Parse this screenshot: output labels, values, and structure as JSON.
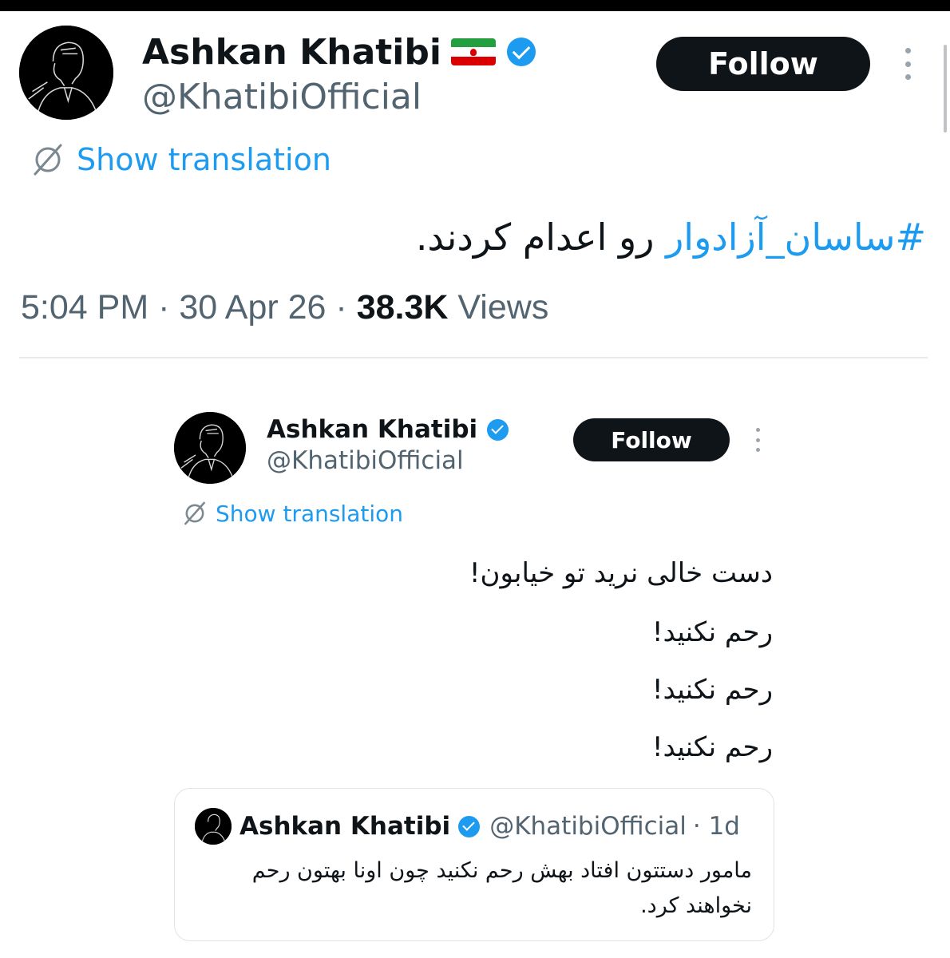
{
  "main_tweet": {
    "author_name": "Ashkan Khatibi",
    "flag_emoji": "🇮🇷",
    "handle": "@KhatibiOfficial",
    "follow_label": "Follow",
    "show_translation_label": "Show translation",
    "hashtag": "#ساسان_آزادوار",
    "text_rest": " رو اعدام کردند.",
    "time": "5:04 PM",
    "date": "30 Apr 26",
    "views_count": "38.3K",
    "views_label": "Views",
    "separator": "·"
  },
  "embedded_tweet": {
    "author_name": "Ashkan Khatibi",
    "handle": "@KhatibiOfficial",
    "follow_label": "Follow",
    "show_translation_label": "Show translation",
    "lines": [
      "دست خالی نرید تو خیابون!",
      "رحم نکنید!",
      "رحم نکنید!",
      "رحم نکنید!"
    ]
  },
  "quoted_tweet": {
    "author_name": "Ashkan Khatibi",
    "handle": "@KhatibiOfficial",
    "age": "· 1d",
    "text_line_1": "مامور دستتون افتاد بهش رحم نکنید چون اونا بهتون رحم",
    "text_line_2": "نخواهند کرد."
  },
  "colors": {
    "accent": "#1d9bf0",
    "text": "#0f1419",
    "secondary": "#536471",
    "button_bg": "#0f1419"
  },
  "icons": [
    "avatar-icon",
    "verified-badge-icon",
    "iran-flag-icon",
    "translate-icon",
    "more-options-icon"
  ]
}
